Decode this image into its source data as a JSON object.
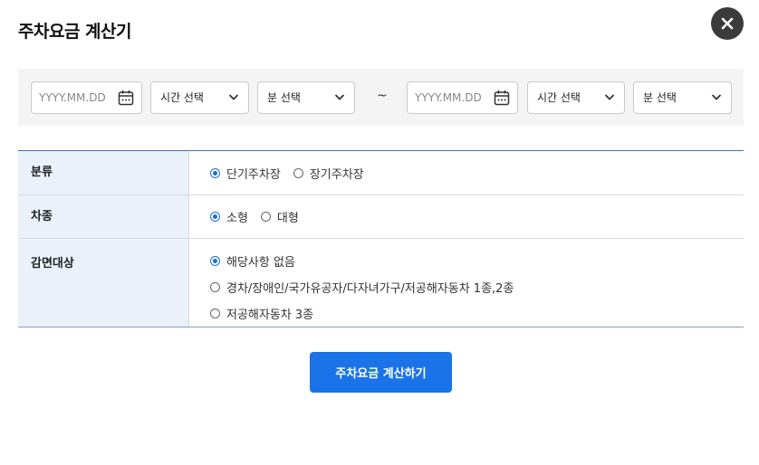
{
  "dialog": {
    "title": "주차요금 계산기",
    "close_icon": "close-icon"
  },
  "period": {
    "start": {
      "date_placeholder": "YYYY.MM.DD",
      "hour_select": "시간 선택",
      "minute_select": "분 선택"
    },
    "separator": "~",
    "end": {
      "date_placeholder": "YYYY.MM.DD",
      "hour_select": "시간 선택",
      "minute_select": "분 선택"
    }
  },
  "form": {
    "category": {
      "label": "분류",
      "options": [
        {
          "label": "단기주차장",
          "selected": true
        },
        {
          "label": "장기주차장",
          "selected": false
        }
      ]
    },
    "vehicle_type": {
      "label": "차종",
      "options": [
        {
          "label": "소형",
          "selected": true
        },
        {
          "label": "대형",
          "selected": false
        }
      ]
    },
    "discount": {
      "label": "감면대상",
      "options": [
        {
          "label": "해당사항 없음",
          "selected": true
        },
        {
          "label": "경차/장애인/국가유공자/다자녀가구/저공해자동차 1종,2종",
          "selected": false
        },
        {
          "label": "저공해자동차 3종",
          "selected": false
        }
      ]
    }
  },
  "actions": {
    "calculate_label": "주차요금 계산하기"
  },
  "colors": {
    "accent": "#1a73e8",
    "header_bg": "#eaf1fb",
    "close_bg": "#3b3b3b"
  }
}
